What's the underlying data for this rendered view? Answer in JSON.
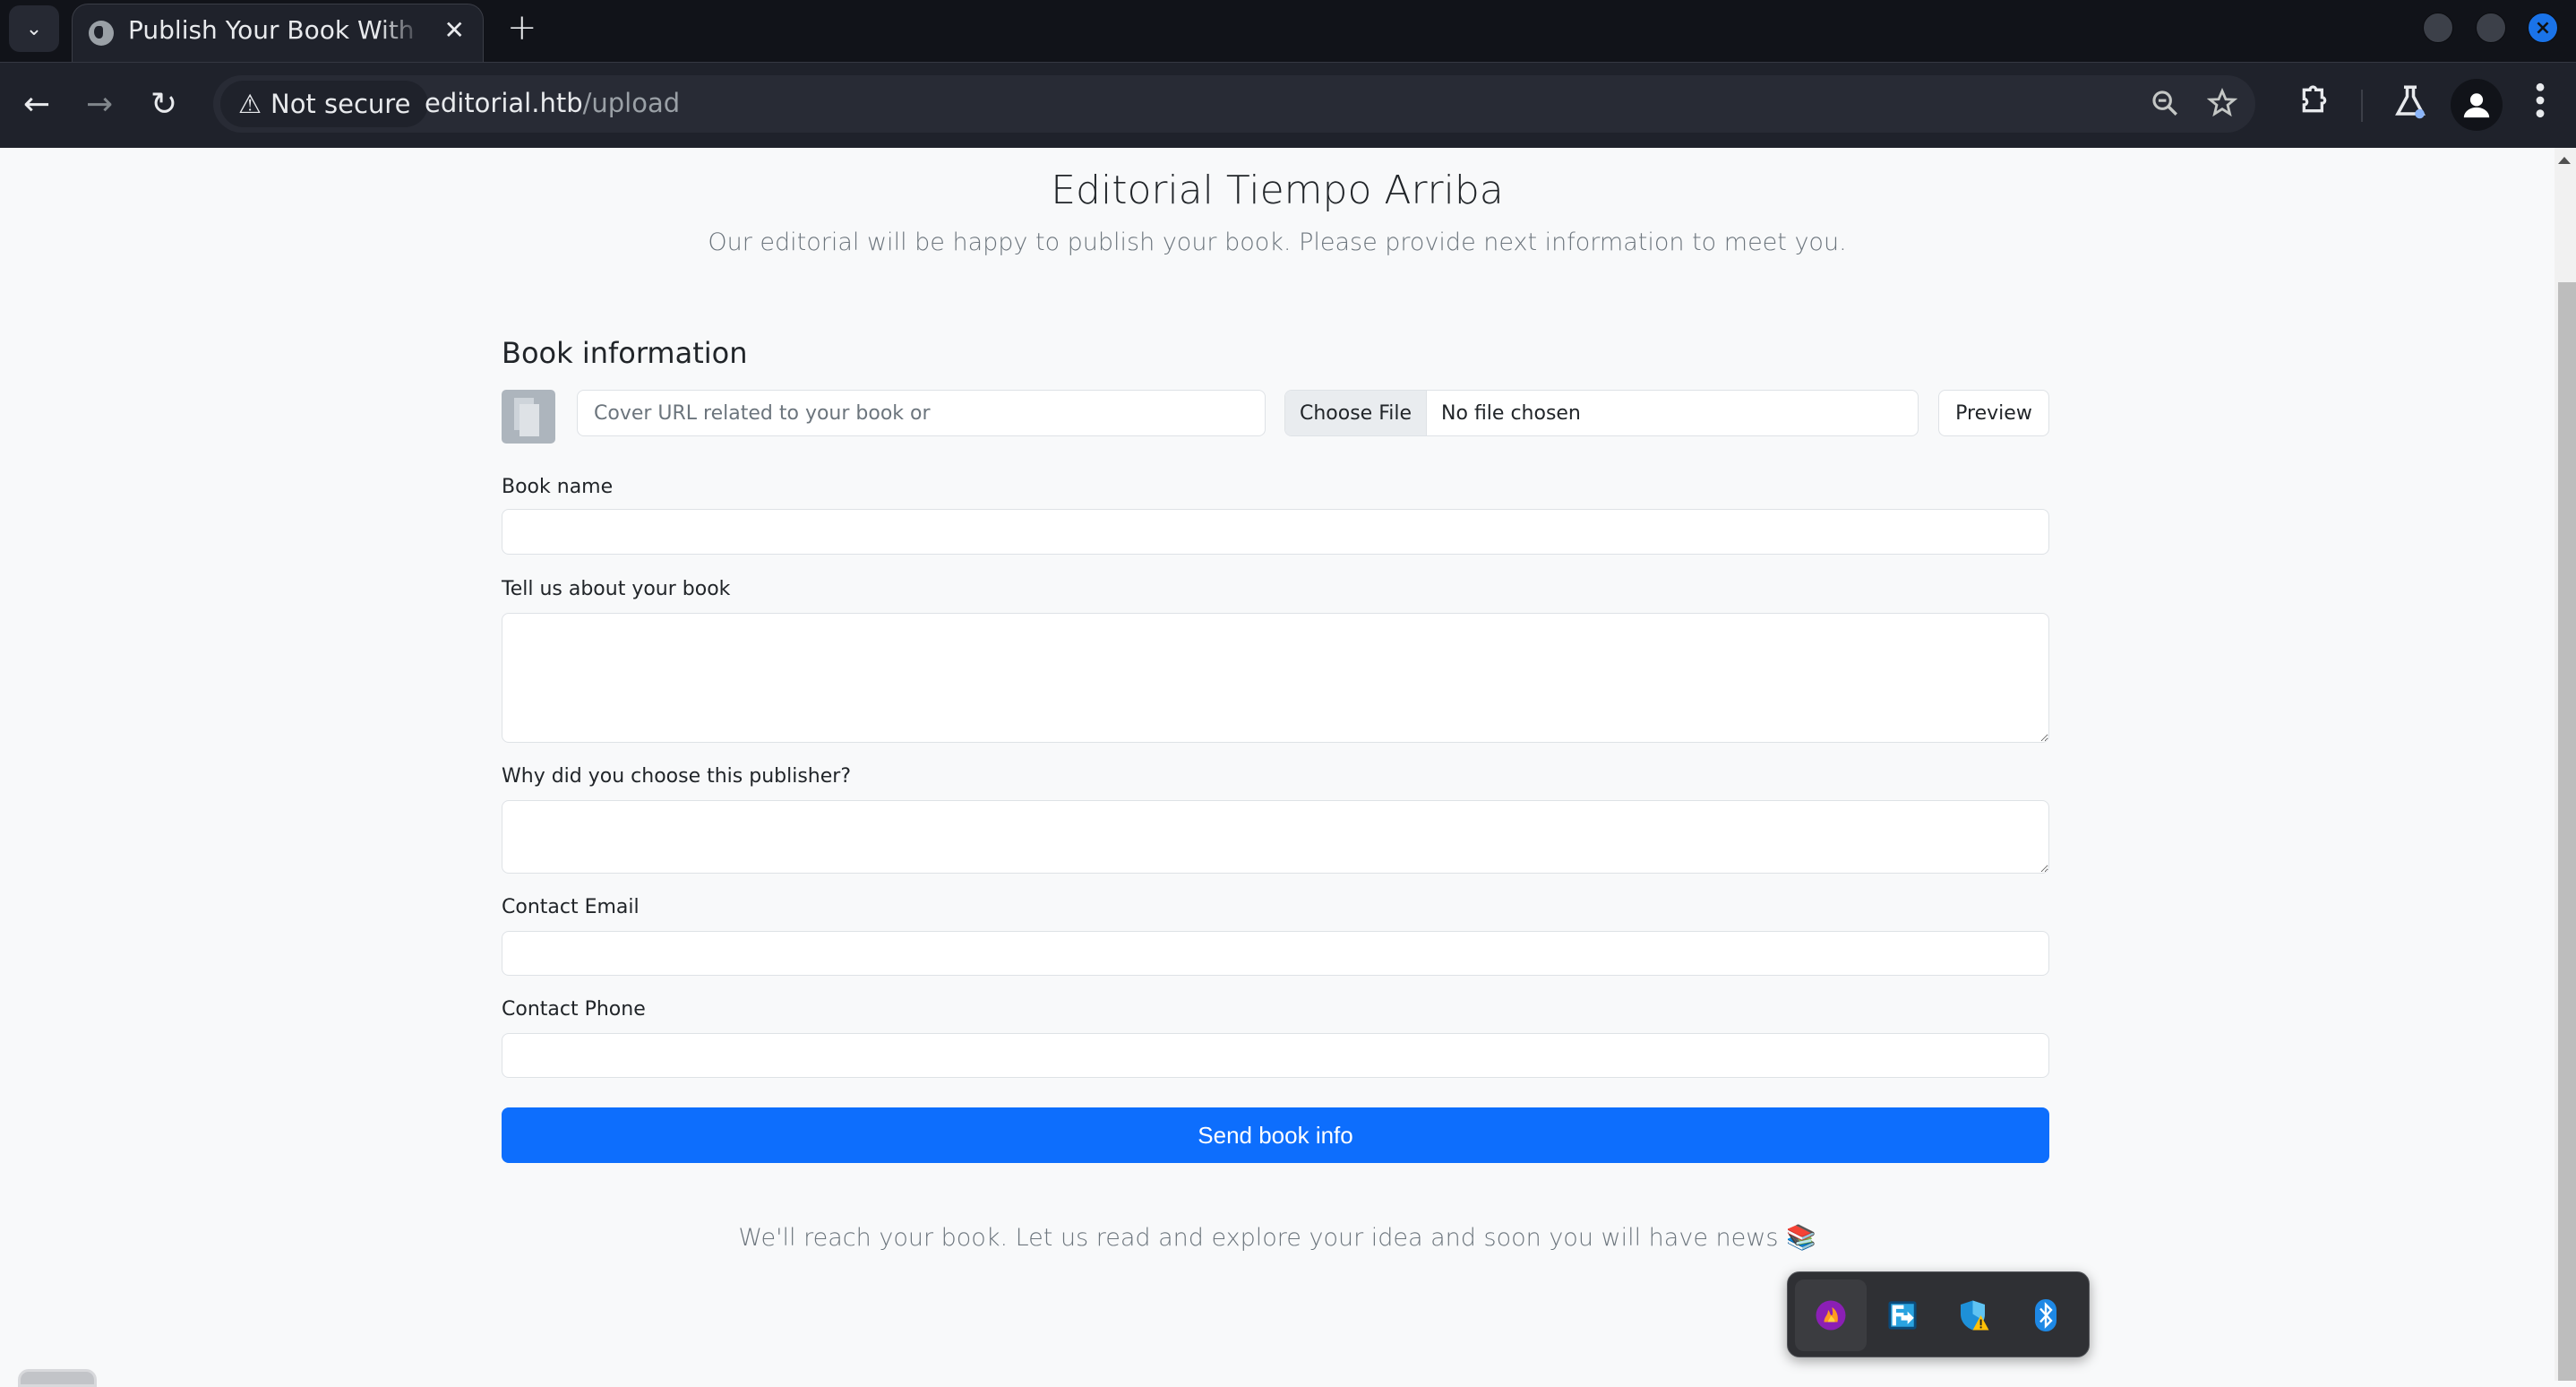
{
  "browser": {
    "tab": {
      "title": "Publish Your Book With Us",
      "favicon": "globe-icon"
    },
    "new_tab_label": "+",
    "security_label": "Not secure",
    "url_host": "editorial.htb",
    "url_path": "/upload",
    "window_controls": [
      "minimize",
      "maximize",
      "close"
    ],
    "toolbar_icons": [
      "zoom-out-icon",
      "bookmark-star-icon",
      "extensions-icon",
      "labs-icon",
      "profile-icon",
      "menu-icon"
    ]
  },
  "page": {
    "site_title": "Editorial Tiempo Arriba",
    "site_subtitle": "Our editorial will be happy to publish your book. Please provide next information to meet you.",
    "section_title": "Book information",
    "cover": {
      "url_placeholder": "Cover URL related to your book or",
      "file_button": "Choose File",
      "file_status": "No file chosen",
      "preview_button": "Preview"
    },
    "fields": [
      {
        "label": "Book name",
        "value": ""
      },
      {
        "label": "Tell us about your book",
        "value": ""
      },
      {
        "label": "Why did you choose this publisher?",
        "value": ""
      },
      {
        "label": "Contact Email",
        "value": ""
      },
      {
        "label": "Contact Phone",
        "value": ""
      }
    ],
    "submit_label": "Send book info",
    "footer_text": "We'll reach your book. Let us read and explore your idea and soon you will have news 📚",
    "accent_color": "#0d6efd"
  },
  "tray": {
    "icons": [
      "flameshot-icon",
      "remote-desktop-icon",
      "security-warning-icon",
      "bluetooth-icon"
    ]
  }
}
